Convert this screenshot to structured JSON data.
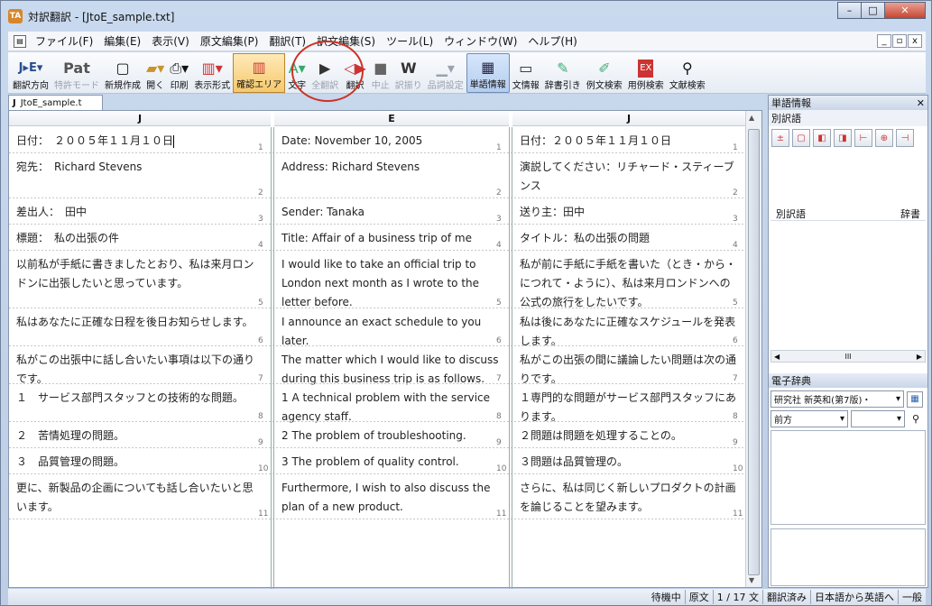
{
  "window": {
    "title": "対訳翻訳 - [JtoE_sample.txt]",
    "app_icon": "TA",
    "buttons": {
      "minimize": "–",
      "maximize": "□",
      "close": "✕"
    }
  },
  "menu": {
    "items": [
      "ファイル(F)",
      "編集(E)",
      "表示(V)",
      "原文編集(P)",
      "翻訳(T)",
      "訳文編集(S)",
      "ツール(L)",
      "ウィンドウ(W)",
      "ヘルプ(H)"
    ],
    "mdi": [
      "_",
      "▫",
      "x"
    ]
  },
  "toolbar": {
    "items": [
      {
        "label": "翻訳方向",
        "icon": "J▸E▾"
      },
      {
        "label": "特許モード",
        "icon": "Pat"
      },
      {
        "label": "新規作成",
        "icon": "▢"
      },
      {
        "label": "開く",
        "icon": "▰▾"
      },
      {
        "label": "印刷",
        "icon": "⎙▾"
      },
      {
        "label": "表示形式",
        "icon": "▥▾"
      },
      {
        "label": "確認エリア",
        "icon": "▥"
      },
      {
        "label": "文字",
        "icon": "A▾"
      },
      {
        "label": "全翻訳",
        "icon": "▶"
      },
      {
        "label": "翻訳",
        "icon": "◁▶"
      },
      {
        "label": "中止",
        "icon": "■"
      },
      {
        "label": "訳振り",
        "icon": "W"
      },
      {
        "label": "品詞設定",
        "icon": "▁▾"
      },
      {
        "label": "単語情報",
        "icon": "▦"
      },
      {
        "label": "文情報",
        "icon": "▭"
      },
      {
        "label": "辞書引き",
        "icon": "✎"
      },
      {
        "label": "例文検索",
        "icon": "✐"
      },
      {
        "label": "用例検索",
        "icon": "EX"
      },
      {
        "label": "文献検索",
        "icon": "⚲"
      }
    ]
  },
  "document": {
    "tab_label": "JtoE_sample.t",
    "tab_icon": "J",
    "columns": [
      "J",
      "E",
      "J"
    ],
    "rows": [
      {
        "n": "1",
        "ja": "日付：　２００５年１１月１０日",
        "en": "Date:  November 10, 2005",
        "back": "日付：２００５年１１月１０日"
      },
      {
        "n": "2",
        "ja": "宛先：　Richard Stevens",
        "en": "Address:  Richard Stevens",
        "back": "演説してください：リチャード・スティーブンス"
      },
      {
        "n": "3",
        "ja": "差出人：　田中",
        "en": "Sender:  Tanaka",
        "back": "送り主：田中"
      },
      {
        "n": "4",
        "ja": "標題：　私の出張の件",
        "en": "Title:  Affair of a business trip of me",
        "back": "タイトル：私の出張の問題"
      },
      {
        "n": "5",
        "ja": "以前私が手紙に書きましたとおり、私は来月ロンドンに出張したいと思っています。",
        "en": "I would like to take an official trip to London next month as I wrote to the letter before.",
        "back": "私が前に手紙に手紙を書いた（とき・から・につれて・ように）、私は来月ロンドンへの公式の旅行をしたいです。"
      },
      {
        "n": "6",
        "ja": "私はあなたに正確な日程を後日お知らせします。",
        "en": "I announce an exact schedule to you later.",
        "back": "私は後にあなたに正確なスケジュールを発表します。"
      },
      {
        "n": "7",
        "ja": "私がこの出張中に話し合いたい事項は以下の通りです。",
        "en": "The matter which I would like to discuss during this business trip is as follows.",
        "back": "私がこの出張の間に議論したい問題は次の通りです。"
      },
      {
        "n": "8",
        "ja": "１　サービス部門スタッフとの技術的な問題。",
        "en": "1  A technical problem with the service agency staff.",
        "back": "１専門的な問題がサービス部門スタッフにあります。"
      },
      {
        "n": "9",
        "ja": "２　苦情処理の問題。",
        "en": "2  The problem of troubleshooting.",
        "back": "２問題は問題を処理することの。"
      },
      {
        "n": "10",
        "ja": "３　品質管理の問題。",
        "en": "3  The problem of quality control.",
        "back": "３問題は品質管理の。"
      },
      {
        "n": "11",
        "ja": "更に、新製品の企画についても話し合いたいと思います。",
        "en": "Furthermore, I wish to also discuss the plan of a new product.",
        "back": "さらに、私は同じく新しいプロダクトの計画を論じることを望みます。"
      }
    ]
  },
  "panel": {
    "title": "単語情報",
    "close": "✕",
    "alt_section": "別訳語",
    "list_cols": [
      "別訳語",
      "辞書"
    ],
    "hscroll_mid": "III",
    "dict_title": "電子辞典",
    "dict_select": "研究社 新英和(第7版)・",
    "search_mode": "前方",
    "search_value": ""
  },
  "status": {
    "items": [
      "待機中",
      "原文",
      "1 / 17 文",
      "翻訳済み",
      "日本語から英語へ",
      "一般"
    ]
  },
  "colors": {
    "accent_circle": "#cc3322"
  }
}
